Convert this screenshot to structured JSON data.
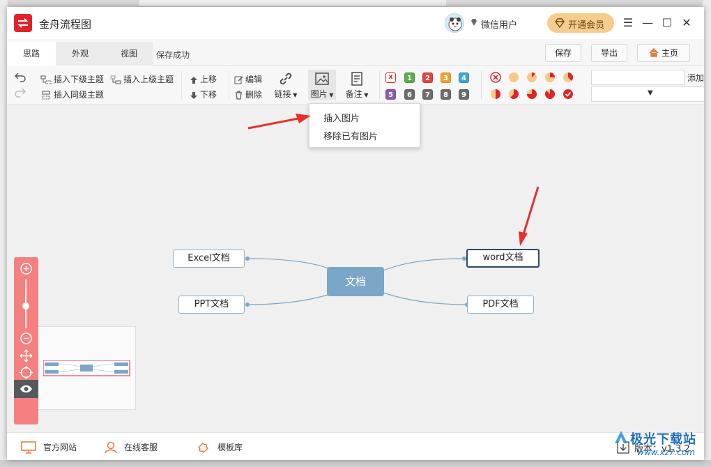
{
  "app": {
    "title": "金舟流程图",
    "user_name": "微信用户",
    "vip_label": "开通会员"
  },
  "tabs": [
    {
      "label": "思路",
      "active": true
    },
    {
      "label": "外观",
      "active": false
    },
    {
      "label": "视图",
      "active": false
    }
  ],
  "save_status": "保存成功",
  "top_buttons": {
    "save": "保存",
    "export": "导出",
    "home": "主页"
  },
  "toolbar": {
    "insert_child": "插入下级主题",
    "insert_parent": "插入上级主题",
    "insert_sibling": "插入同级主题",
    "move_up": "上移",
    "move_down": "下移",
    "edit": "编辑",
    "delete": "删除",
    "link": "链接",
    "image": "图片",
    "note": "备注",
    "add": "添加",
    "priority_badges": [
      "x",
      "1",
      "2",
      "3",
      "4",
      "5",
      "6",
      "7",
      "8",
      "9"
    ],
    "progress_states": [
      "cancel",
      "0%",
      "12.5%",
      "25%",
      "37.5%",
      "50%",
      "62.5%",
      "75%",
      "87.5%",
      "done"
    ]
  },
  "image_menu": {
    "items": [
      "插入图片",
      "移除已有图片"
    ]
  },
  "mindmap": {
    "center": "文档",
    "left_nodes": [
      "Excel文档",
      "PPT文档"
    ],
    "right_nodes": [
      "word文档",
      "PDF文档"
    ],
    "selected": "word文档"
  },
  "bottom": {
    "website": "官方网站",
    "support": "在线客服",
    "templates": "模板库",
    "version": "版本：v1.3.2"
  },
  "watermark": {
    "title": "极光下载站",
    "url": "www.xz7.com"
  },
  "colors": {
    "accent_red": "#e0242b",
    "vip_gold": "#f5cd8e",
    "center_node": "#7aa7c7",
    "node_border": "#8fb0c8",
    "zoom_panel": "#f48080",
    "annotation_arrow": "#e8302a"
  }
}
